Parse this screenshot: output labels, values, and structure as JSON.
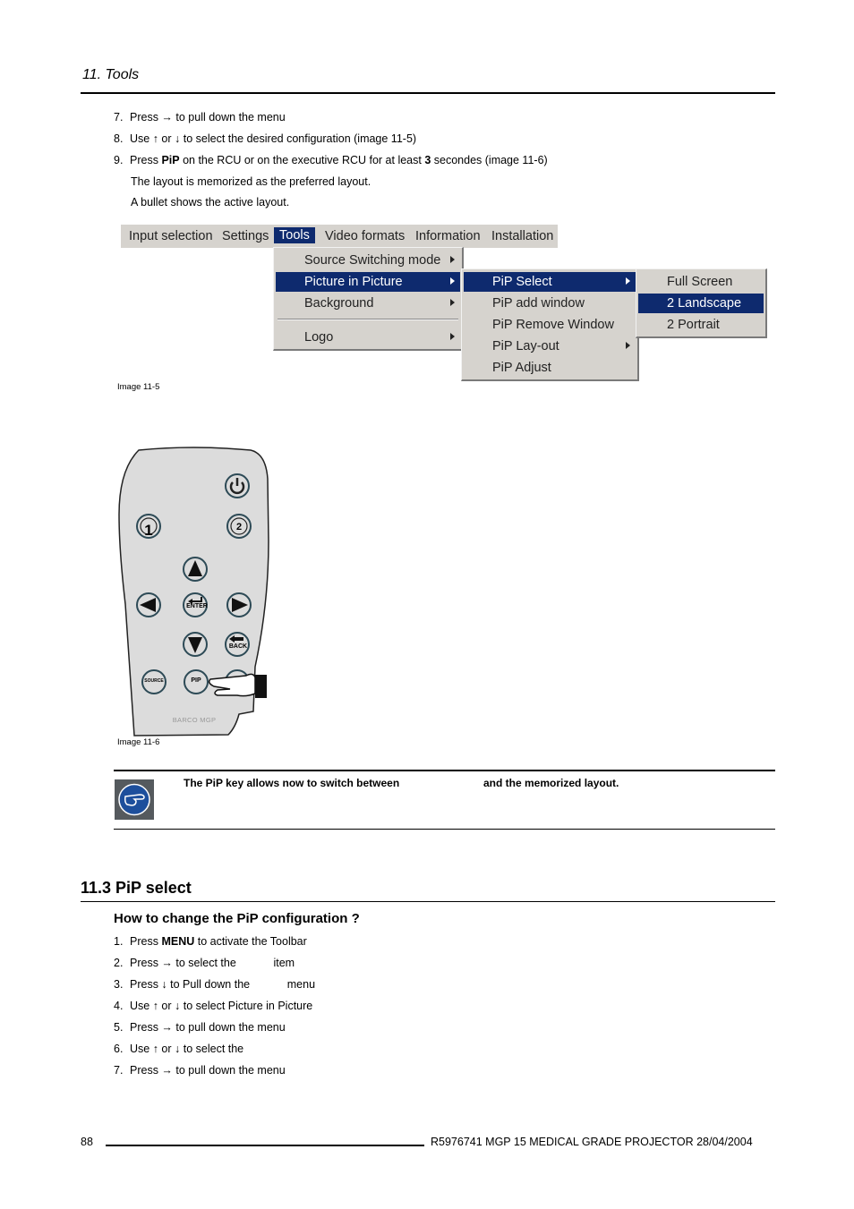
{
  "header": {
    "chapter": "11. Tools"
  },
  "steps_top": [
    {
      "num": "7.",
      "parts": [
        {
          "t": "Press → to pull down the menu"
        }
      ]
    },
    {
      "num": "8.",
      "parts": [
        {
          "t": "Use ↑ or ↓ to select the desired configuration (image 11-5)"
        }
      ]
    },
    {
      "num": "9.",
      "parts": [
        {
          "t": "Press "
        },
        {
          "t": "PiP",
          "b": true
        },
        {
          "t": " on the RCU or on the executive RCU for at least "
        },
        {
          "t": "3",
          "b": true
        },
        {
          "t": " secondes (image 11-6)"
        }
      ]
    }
  ],
  "step9_notes": [
    "The layout is memorized as the preferred layout.",
    "A bullet shows the active layout."
  ],
  "menu": {
    "bar": [
      "Input selection",
      "Settings",
      "Tools",
      "Video formats",
      "Information",
      "Installation"
    ],
    "bar_selected": "Tools",
    "tools_items": [
      {
        "label": "Source Switching mode",
        "submenu": true
      },
      {
        "label": "Picture in Picture",
        "submenu": true,
        "highlighted": true
      },
      {
        "label": "Background",
        "submenu": true
      },
      {
        "label": "Logo",
        "submenu": true
      }
    ],
    "pip_items": [
      {
        "label": "PiP Select",
        "submenu": true,
        "highlighted": true
      },
      {
        "label": "PiP add window"
      },
      {
        "label": "PiP Remove Window"
      },
      {
        "label": "PiP Lay-out",
        "submenu": true
      },
      {
        "label": "PiP Adjust"
      }
    ],
    "select_items": [
      {
        "label": "Full Screen"
      },
      {
        "label": "2 Landscape",
        "highlighted": true
      },
      {
        "label": "2 Portrait"
      }
    ],
    "highlight_color": "#0e2a6e",
    "menu_bg": "#d6d3ce"
  },
  "captions": {
    "image_5": "Image 11-5",
    "image_6": "Image 11-6"
  },
  "remote": {
    "buttons": {
      "one": "1",
      "two": "2",
      "enter": "ENTER",
      "back": "BACK",
      "source": "SOURCE",
      "pip": "PIP"
    },
    "brand": "BARCO MGP"
  },
  "note": {
    "text_a": "The PiP key allows now to switch between",
    "text_b": "and the memorized layout.",
    "icon": "pointing-hand-icon"
  },
  "section": {
    "title": "11.3 PiP select",
    "subtitle": "How to change the PiP configuration ?"
  },
  "steps_bottom": [
    {
      "num": "1.",
      "parts": [
        {
          "t": "Press "
        },
        {
          "t": "MENU",
          "b": true
        },
        {
          "t": " to activate the Toolbar"
        }
      ]
    },
    {
      "num": "2.",
      "parts": [
        {
          "t": "Press → to select the            item"
        }
      ]
    },
    {
      "num": "3.",
      "parts": [
        {
          "t": "Press ↓ to Pull down the            menu"
        }
      ]
    },
    {
      "num": "4.",
      "parts": [
        {
          "t": "Use ↑ or ↓ to select Picture in Picture"
        }
      ]
    },
    {
      "num": "5.",
      "parts": [
        {
          "t": "Press → to pull down the menu"
        }
      ]
    },
    {
      "num": "6.",
      "parts": [
        {
          "t": "Use ↑ or ↓ to select the"
        }
      ]
    },
    {
      "num": "7.",
      "parts": [
        {
          "t": "Press → to pull down the menu"
        }
      ]
    }
  ],
  "footer": {
    "page": "88",
    "doc": "R5976741   MGP 15 MEDICAL GRADE PROJECTOR  28/04/2004"
  }
}
